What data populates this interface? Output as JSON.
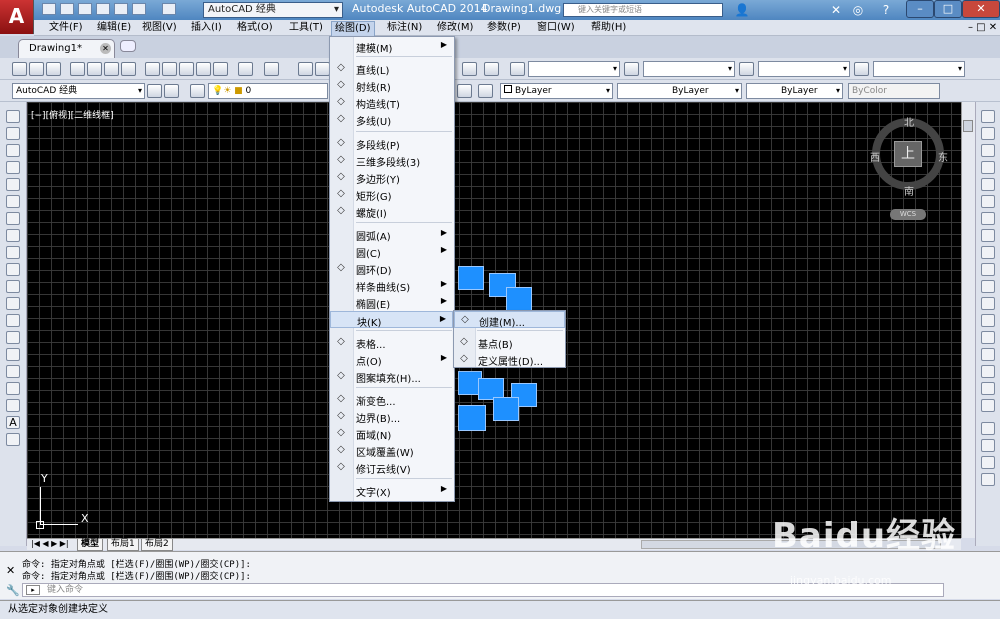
{
  "window": {
    "workspace": "AutoCAD 经典",
    "app_title": "Autodesk AutoCAD 2014",
    "doc_title": "Drawing1.dwg",
    "search_placeholder": "键入关键字或短语"
  },
  "menubar": [
    "文件(F)",
    "编辑(E)",
    "视图(V)",
    "插入(I)",
    "格式(O)",
    "工具(T)",
    "绘图(D)",
    "标注(N)",
    "修改(M)",
    "参数(P)",
    "窗口(W)",
    "帮助(H)"
  ],
  "document_tab": "Drawing1*",
  "toolbar2": {
    "workspace_combo": "AutoCAD 经典",
    "layer_value": "0",
    "color": "ByLayer",
    "linetype": "ByLayer",
    "lineweight": "ByLayer",
    "plotstyle": "ByColor"
  },
  "viewport_label": "[−][俯视][二维线框]",
  "viewcube": {
    "north": "北",
    "south": "南",
    "west": "西",
    "east": "东",
    "top": "上",
    "wcs": "WCS"
  },
  "ucs": {
    "x": "X",
    "y": "Y"
  },
  "layout_tabs": [
    "模型",
    "布局1",
    "布局2"
  ],
  "draw_menu": {
    "items": [
      {
        "label": "建模(M)",
        "sub": true,
        "icon": ""
      },
      {
        "label": "直线(L)",
        "sub": false,
        "icon": "line-icon"
      },
      {
        "label": "射线(R)",
        "sub": false,
        "icon": "ray-icon"
      },
      {
        "label": "构造线(T)",
        "sub": false,
        "icon": "xline-icon"
      },
      {
        "label": "多线(U)",
        "sub": false,
        "icon": "mline-icon"
      },
      {
        "label": "多段线(P)",
        "sub": false,
        "icon": "polyline-icon"
      },
      {
        "label": "三维多段线(3)",
        "sub": false,
        "icon": "3dpoly-icon"
      },
      {
        "label": "多边形(Y)",
        "sub": false,
        "icon": "polygon-icon"
      },
      {
        "label": "矩形(G)",
        "sub": false,
        "icon": "rectangle-icon"
      },
      {
        "label": "螺旋(I)",
        "sub": false,
        "icon": "helix-icon"
      },
      {
        "label": "圆弧(A)",
        "sub": true,
        "icon": ""
      },
      {
        "label": "圆(C)",
        "sub": true,
        "icon": ""
      },
      {
        "label": "圆环(D)",
        "sub": false,
        "icon": "donut-icon"
      },
      {
        "label": "样条曲线(S)",
        "sub": true,
        "icon": ""
      },
      {
        "label": "椭圆(E)",
        "sub": true,
        "icon": ""
      },
      {
        "label": "块(K)",
        "sub": true,
        "icon": ""
      },
      {
        "label": "表格...",
        "sub": false,
        "icon": "table-icon"
      },
      {
        "label": "点(O)",
        "sub": true,
        "icon": ""
      },
      {
        "label": "图案填充(H)...",
        "sub": false,
        "icon": "hatch-icon"
      },
      {
        "label": "渐变色...",
        "sub": false,
        "icon": "gradient-icon"
      },
      {
        "label": "边界(B)...",
        "sub": false,
        "icon": "boundary-icon"
      },
      {
        "label": "面域(N)",
        "sub": false,
        "icon": "region-icon"
      },
      {
        "label": "区域覆盖(W)",
        "sub": false,
        "icon": "wipeout-icon"
      },
      {
        "label": "修订云线(V)",
        "sub": false,
        "icon": "revcloud-icon"
      },
      {
        "label": "文字(X)",
        "sub": true,
        "icon": ""
      }
    ]
  },
  "block_menu": {
    "items": [
      {
        "label": "创建(M)...",
        "icon": "block-create-icon"
      },
      {
        "label": "基点(B)",
        "icon": "basepoint-icon"
      },
      {
        "label": "定义属性(D)...",
        "icon": "attdef-icon"
      }
    ]
  },
  "command": {
    "history": [
      "命令: 指定对角点或 [栏选(F)/圈围(WP)/圈交(CP)]:",
      "命令: 指定对角点或 [栏选(F)/圈围(WP)/圈交(CP)]:"
    ],
    "input_placeholder": "键入命令"
  },
  "status_text": "从选定对象创建块定义",
  "watermark": {
    "brand": "Baidu经验",
    "url": "jingyan.baidu.com"
  },
  "colors": {
    "selection": "#1e90ff",
    "canvas": "#000000"
  }
}
